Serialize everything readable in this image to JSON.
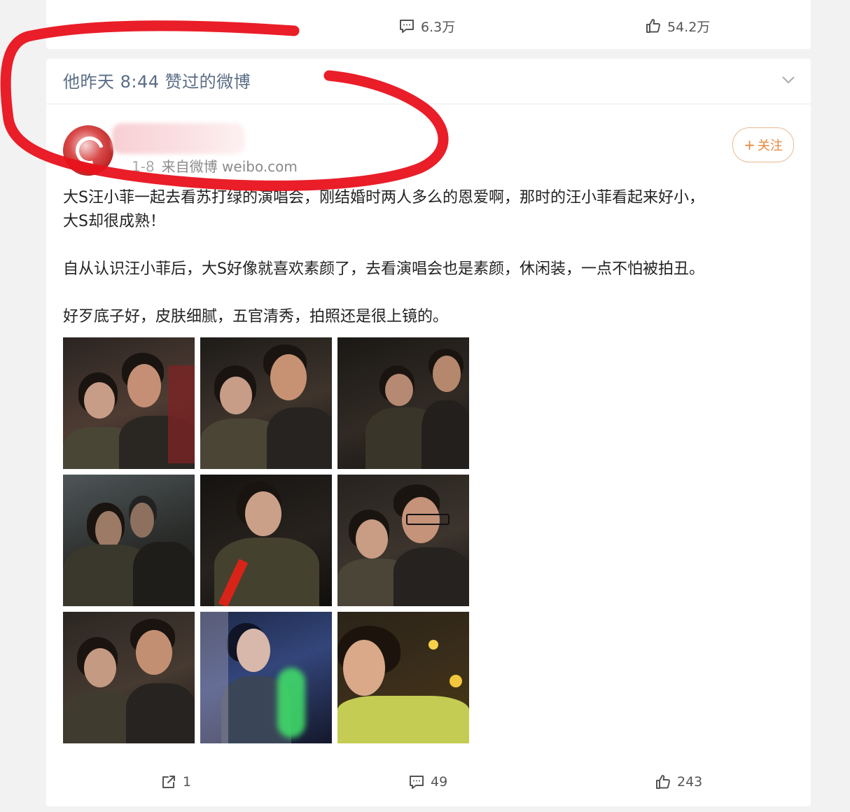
{
  "prev_post": {
    "comments": "6.3万",
    "likes": "54.2万"
  },
  "liked_header": {
    "text": "他昨天 8:44 赞过的微博"
  },
  "post": {
    "date": "1-8",
    "source": "来自微博 weibo.com",
    "follow_label": "关注",
    "follow_plus": "+",
    "paragraphs": [
      "大S汪小菲一起去看苏打绿的演唱会，刚结婚时两人多么的恩爱啊，那时的汪小菲看起来好小，",
      "大S却很成熟！",
      "自从认识汪小菲后，大S好像就喜欢素颜了，去看演唱会也是素颜，休闲装，一点不怕被拍丑。",
      "好歹底子好，皮肤细腻，五官清秀，拍照还是很上镜的。"
    ],
    "reposts": "1",
    "comments": "49",
    "likes": "243"
  },
  "colors": {
    "accent_follow": "#e7863a",
    "annotation_red": "#e8121c",
    "header_text": "#5a6d86"
  }
}
